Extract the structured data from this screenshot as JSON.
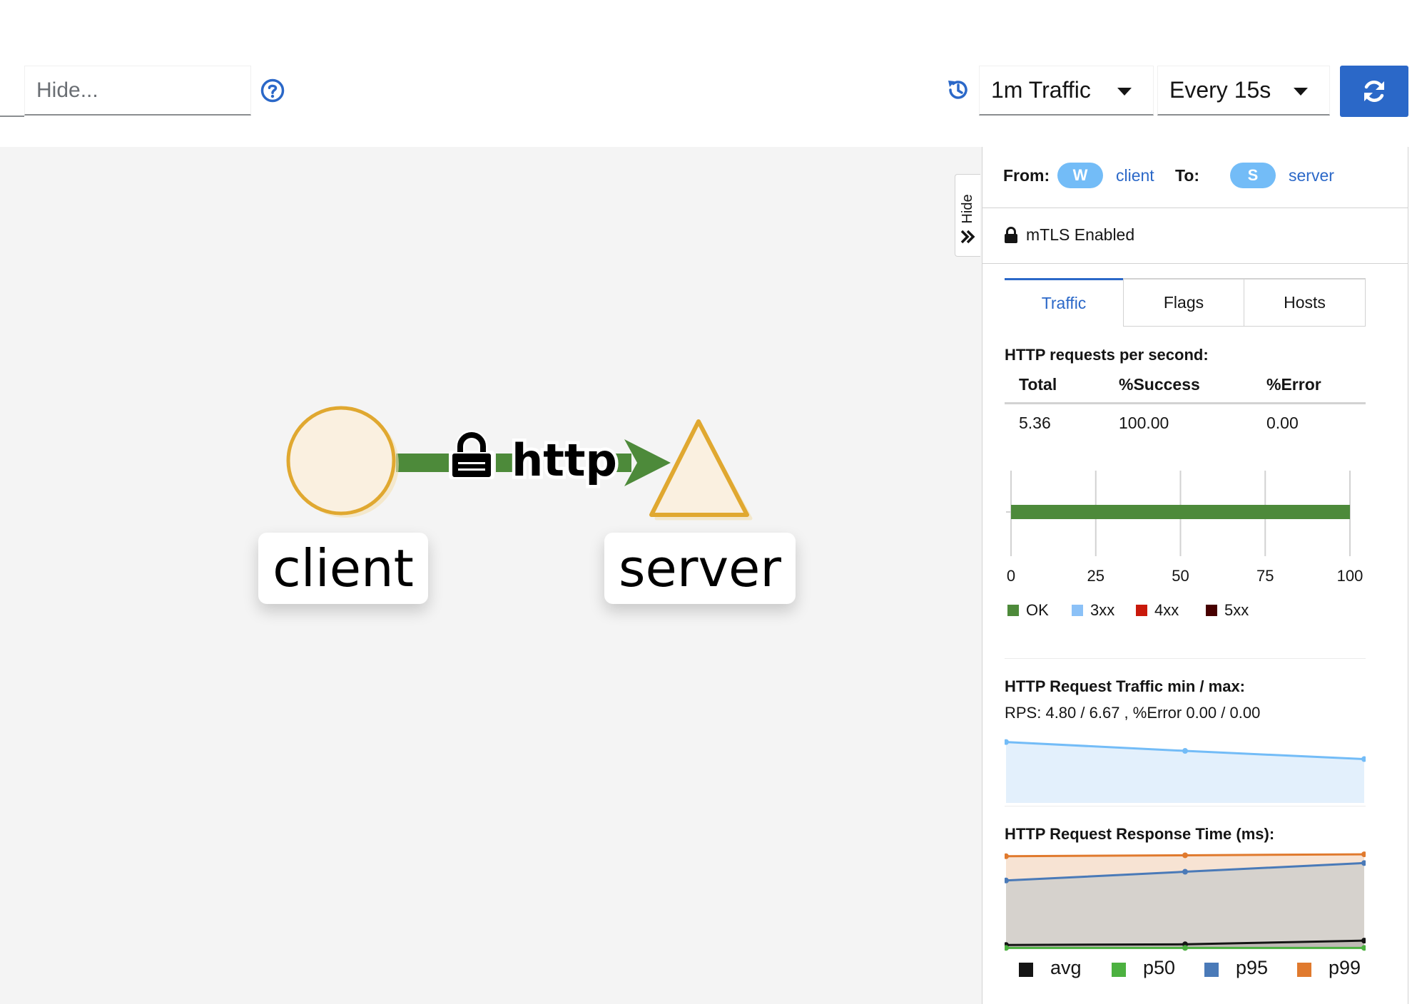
{
  "toolbar": {
    "hide_placeholder": "Hide...",
    "duration_label": "1m Traffic",
    "refresh_interval_label": "Every 15s",
    "accent_color": "#2b68c8"
  },
  "graph": {
    "source_node_label": "client",
    "target_node_label": "server",
    "edge_protocol": "http",
    "edge_color": "#4d8a3a",
    "node_border_color": "#e0a830",
    "node_fill_color": "#faf0e0"
  },
  "hide_tab": {
    "label": "Hide"
  },
  "panel": {
    "from_label": "From:",
    "from_badge": "W",
    "from_name": "client",
    "to_label": "To:",
    "to_badge": "S",
    "to_name": "server",
    "mtls_text": "mTLS Enabled",
    "tabs": [
      {
        "label": "Traffic",
        "active": true
      },
      {
        "label": "Flags",
        "active": false
      },
      {
        "label": "Hosts",
        "active": false
      }
    ],
    "rps_title": "HTTP requests per second:",
    "rps_table": {
      "headers": [
        "Total",
        "%Success",
        "%Error"
      ],
      "row": [
        "5.36",
        "100.00",
        "0.00"
      ]
    },
    "traffic_title": "HTTP Request Traffic min / max:",
    "traffic_summary": "RPS: 4.80 / 6.67 , %Error 0.00 / 0.00",
    "response_title": "HTTP Request Response Time (ms):"
  },
  "chart_data": [
    {
      "type": "bar",
      "orientation": "horizontal",
      "stacked": true,
      "categories": [
        ""
      ],
      "series": [
        {
          "name": "OK",
          "values": [
            100
          ],
          "color": "#4d8a3a"
        },
        {
          "name": "3xx",
          "values": [
            0
          ],
          "color": "#8bc1f7"
        },
        {
          "name": "4xx",
          "values": [
            0
          ],
          "color": "#c9190b"
        },
        {
          "name": "5xx",
          "values": [
            0
          ],
          "color": "#470000"
        }
      ],
      "xticks": [
        "0",
        "25",
        "50",
        "75",
        "100"
      ],
      "xlim": [
        0,
        100
      ],
      "grid": true,
      "legend_position": "bottom"
    },
    {
      "type": "area",
      "x": [
        0,
        1,
        2
      ],
      "series": [
        {
          "name": "",
          "values": [
            6.67,
            5.7,
            4.8
          ],
          "color": "#73bcf7"
        }
      ],
      "ylim": [
        0,
        7.5
      ],
      "grid": false
    },
    {
      "type": "area",
      "x": [
        0,
        1,
        2
      ],
      "series": [
        {
          "name": "avg",
          "values": [
            3.5,
            4.2,
            8.0
          ],
          "color": "#151515"
        },
        {
          "name": "p50",
          "values": [
            0.5,
            0.5,
            0.5
          ],
          "color": "#4cb140"
        },
        {
          "name": "p95",
          "values": [
            70,
            79,
            88
          ],
          "color": "#4a7ab8"
        },
        {
          "name": "p99",
          "values": [
            95,
            96,
            97
          ],
          "color": "#e07a2e"
        }
      ],
      "ylim": [
        0,
        100
      ],
      "grid": false,
      "legend_position": "bottom"
    }
  ]
}
